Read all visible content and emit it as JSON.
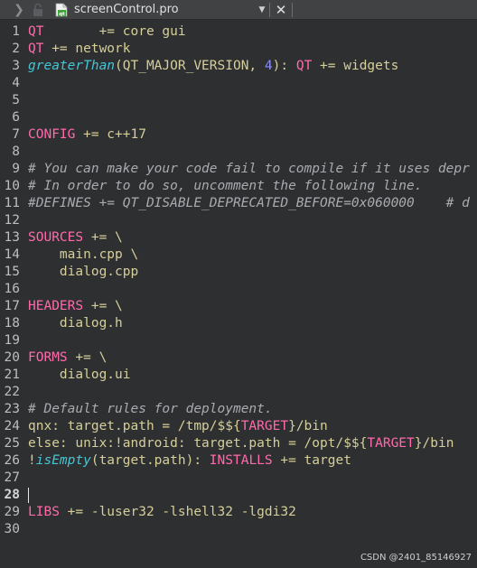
{
  "tab": {
    "filename": "screenControl.pro",
    "back_arrow": "❯",
    "dropdown": "▼",
    "close": "✕"
  },
  "icons": {
    "lock": "lock-icon",
    "file": "qt-project-file-icon"
  },
  "colors": {
    "keyword": "#ff6aad",
    "plain": "#d6cf9a",
    "function": "#45c6d6",
    "comment": "#a8abb0",
    "number": "#8a8cff",
    "background": "#2e2f30"
  },
  "editor": {
    "current_line": 28,
    "lines": [
      {
        "n": "1",
        "tokens": [
          {
            "t": "QT",
            "c": "kw"
          },
          {
            "t": "       += core gui",
            "c": "plain"
          }
        ]
      },
      {
        "n": "2",
        "tokens": [
          {
            "t": "QT",
            "c": "kw"
          },
          {
            "t": " += network",
            "c": "plain"
          }
        ]
      },
      {
        "n": "3",
        "tokens": [
          {
            "t": "greaterThan",
            "c": "fn"
          },
          {
            "t": "(QT_MAJOR_VERSION, ",
            "c": "plain"
          },
          {
            "t": "4",
            "c": "num"
          },
          {
            "t": "): ",
            "c": "plain"
          },
          {
            "t": "QT",
            "c": "kw"
          },
          {
            "t": " += widgets",
            "c": "plain"
          }
        ]
      },
      {
        "n": "4",
        "tokens": []
      },
      {
        "n": "5",
        "tokens": []
      },
      {
        "n": "6",
        "tokens": []
      },
      {
        "n": "7",
        "tokens": [
          {
            "t": "CONFIG",
            "c": "kw"
          },
          {
            "t": " += c++17",
            "c": "plain"
          }
        ]
      },
      {
        "n": "8",
        "tokens": []
      },
      {
        "n": "9",
        "tokens": [
          {
            "t": "# You can make your code fail to compile if it uses depr",
            "c": "comment"
          }
        ]
      },
      {
        "n": "10",
        "tokens": [
          {
            "t": "# In order to do so, uncomment the following line.",
            "c": "comment"
          }
        ]
      },
      {
        "n": "11",
        "tokens": [
          {
            "t": "#DEFINES += QT_DISABLE_DEPRECATED_BEFORE=0x060000    # d",
            "c": "comment"
          }
        ]
      },
      {
        "n": "12",
        "tokens": []
      },
      {
        "n": "13",
        "tokens": [
          {
            "t": "SOURCES",
            "c": "kw"
          },
          {
            "t": " += \\",
            "c": "plain"
          }
        ]
      },
      {
        "n": "14",
        "tokens": [
          {
            "t": "    main.cpp \\",
            "c": "plain"
          }
        ]
      },
      {
        "n": "15",
        "tokens": [
          {
            "t": "    dialog.cpp",
            "c": "plain"
          }
        ]
      },
      {
        "n": "16",
        "tokens": []
      },
      {
        "n": "17",
        "tokens": [
          {
            "t": "HEADERS",
            "c": "kw"
          },
          {
            "t": " += \\",
            "c": "plain"
          }
        ]
      },
      {
        "n": "18",
        "tokens": [
          {
            "t": "    dialog.h",
            "c": "plain"
          }
        ]
      },
      {
        "n": "19",
        "tokens": []
      },
      {
        "n": "20",
        "tokens": [
          {
            "t": "FORMS",
            "c": "kw"
          },
          {
            "t": " += \\",
            "c": "plain"
          }
        ]
      },
      {
        "n": "21",
        "tokens": [
          {
            "t": "    dialog.ui",
            "c": "plain"
          }
        ]
      },
      {
        "n": "22",
        "tokens": []
      },
      {
        "n": "23",
        "tokens": [
          {
            "t": "# Default rules for deployment.",
            "c": "comment"
          }
        ]
      },
      {
        "n": "24",
        "tokens": [
          {
            "t": "qnx: target.path = /tmp/$${",
            "c": "plain"
          },
          {
            "t": "TARGET",
            "c": "kw"
          },
          {
            "t": "}/bin",
            "c": "plain"
          }
        ]
      },
      {
        "n": "25",
        "tokens": [
          {
            "t": "else: unix:!android: target.path = /opt/$${",
            "c": "plain"
          },
          {
            "t": "TARGET",
            "c": "kw"
          },
          {
            "t": "}/bin",
            "c": "plain"
          }
        ]
      },
      {
        "n": "26",
        "tokens": [
          {
            "t": "!",
            "c": "plain"
          },
          {
            "t": "isEmpty",
            "c": "fn"
          },
          {
            "t": "(target.path): ",
            "c": "plain"
          },
          {
            "t": "INSTALLS",
            "c": "kw"
          },
          {
            "t": " += target",
            "c": "plain"
          }
        ]
      },
      {
        "n": "27",
        "tokens": []
      },
      {
        "n": "28",
        "tokens": []
      },
      {
        "n": "29",
        "tokens": [
          {
            "t": "LIBS",
            "c": "kw"
          },
          {
            "t": " += -luser32 -lshell32 -lgdi32",
            "c": "plain"
          }
        ]
      },
      {
        "n": "30",
        "tokens": []
      }
    ]
  },
  "watermark": "CSDN @2401_85146927"
}
